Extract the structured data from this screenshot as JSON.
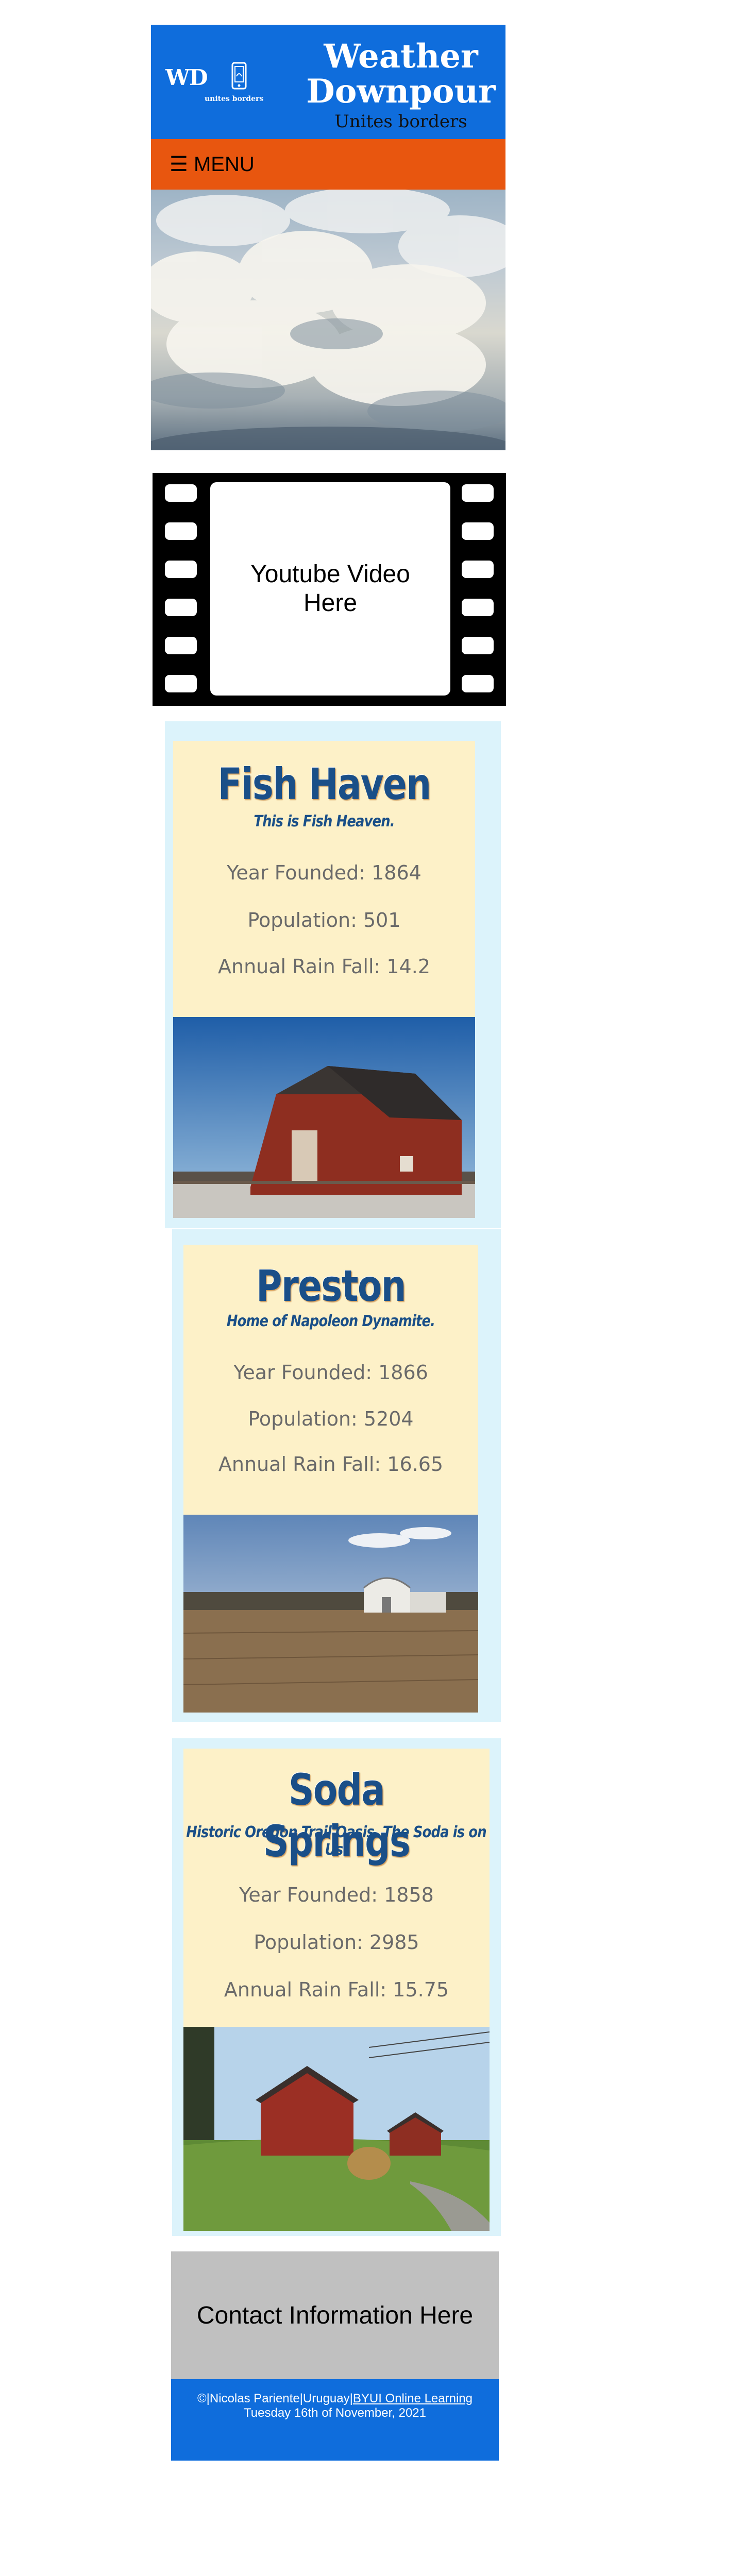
{
  "header": {
    "logo_text": "WD",
    "logo_tagline": "unites borders",
    "title_line1": "Weather",
    "title_line2": "Downpour",
    "subtitle": "Unites borders",
    "brand_color": "#0f6ddc"
  },
  "menu": {
    "label": "☰ MENU",
    "color": "#e8560f"
  },
  "video": {
    "placeholder": "Youtube Video Here"
  },
  "towns": [
    {
      "name": "Fish Haven",
      "motto": "This is Fish Heaven.",
      "year_founded": "Year Founded: 1864",
      "population": "Population: 501",
      "rainfall": "Annual Rain Fall: 14.2"
    },
    {
      "name": "Preston",
      "motto": "Home of Napoleon Dynamite.",
      "year_founded": "Year Founded: 1866",
      "population": "Population: 5204",
      "rainfall": "Annual Rain Fall: 16.65"
    },
    {
      "name": "Soda Springs",
      "motto": "Historic Oregon Trail Oasis. The Soda is on Us.",
      "year_founded": "Year Founded: 1858",
      "population": "Population: 2985",
      "rainfall": "Annual Rain Fall: 15.75"
    }
  ],
  "contact": {
    "label": "Contact Information Here"
  },
  "footer": {
    "copyright": "©|Nicolas Pariente|Uruguay|",
    "link_text": "BYUI Online Learning",
    "date": "Tuesday 16th of November, 2021"
  }
}
